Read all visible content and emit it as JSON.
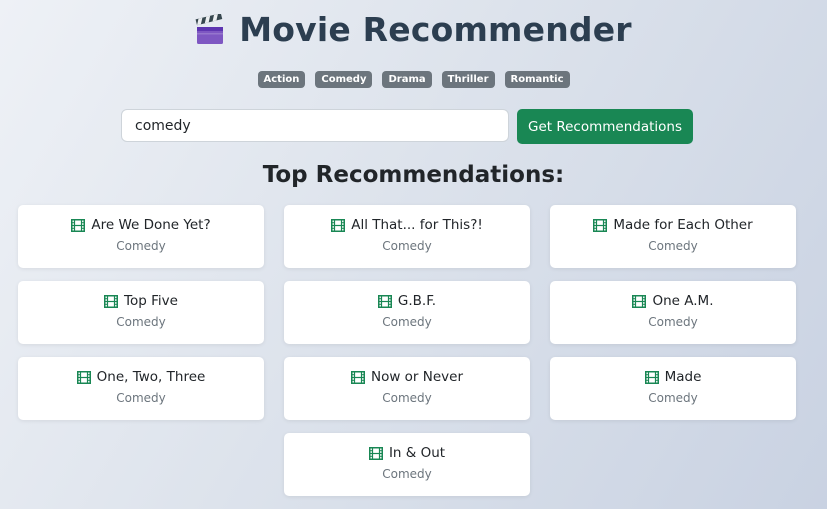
{
  "header": {
    "icon": "clapperboard-icon",
    "title": "Movie Recommender"
  },
  "tags": [
    "Action",
    "Comedy",
    "Drama",
    "Thriller",
    "Romantic"
  ],
  "search": {
    "value": "comedy",
    "button_label": "Get Recommendations"
  },
  "results": {
    "heading": "Top Recommendations:",
    "item_icon": "film-icon",
    "items": [
      {
        "title": "Are We Done Yet?",
        "genre": "Comedy"
      },
      {
        "title": "All That... for This?!",
        "genre": "Comedy"
      },
      {
        "title": "Made for Each Other",
        "genre": "Comedy"
      },
      {
        "title": "Top Five",
        "genre": "Comedy"
      },
      {
        "title": "G.B.F.",
        "genre": "Comedy"
      },
      {
        "title": "One A.M.",
        "genre": "Comedy"
      },
      {
        "title": "One, Two, Three",
        "genre": "Comedy"
      },
      {
        "title": "Now or Never",
        "genre": "Comedy"
      },
      {
        "title": "Made",
        "genre": "Comedy"
      },
      {
        "title": "In & Out",
        "genre": "Comedy"
      }
    ]
  },
  "colors": {
    "title": "#2c3e50",
    "tag_bg": "#6c757d",
    "button_bg": "#198754",
    "film_icon": "#198754"
  }
}
